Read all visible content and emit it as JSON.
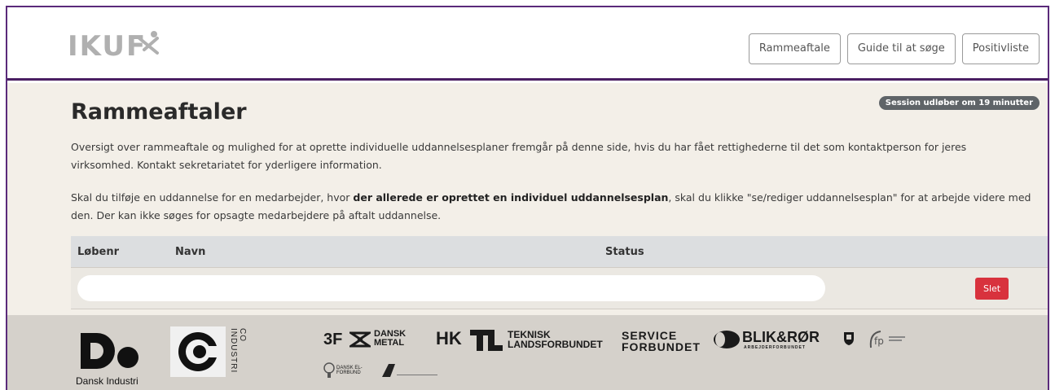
{
  "header": {
    "logo_text": "IKUF",
    "nav": [
      "Rammeaftale",
      "Guide til at søge",
      "Positivliste"
    ]
  },
  "session_badge": "Session udløber om 19 minutter",
  "page_title": "Rammeaftaler",
  "intro": "Oversigt over rammeaftale og mulighed for at oprette individuelle uddannelsesplaner fremgår på denne side, hvis du har fået rettighederne til det som kontaktperson for jeres virksomhed. Kontakt sekretariatet for yderligere information.",
  "instructions": {
    "before": "Skal du tilføje en uddannelse for en medarbejder, hvor ",
    "bold": "der allerede er oprettet en individuel uddannelsesplan",
    "after": ", skal du klikke \"se/rediger uddannelsesplan\" for at arbejde videre med den. Der kan ikke søges for opsagte medarbejdere på aftalt uddannelse."
  },
  "table": {
    "columns": [
      "Løbenr",
      "Navn",
      "Status"
    ],
    "row": {
      "delete_label": "Slet"
    }
  },
  "footer": {
    "partners": [
      {
        "name": "Dansk Industri"
      },
      {
        "name": "CO INDUSTRI"
      },
      {
        "name": "3F"
      },
      {
        "name": "DANSK METAL"
      },
      {
        "name": "HK"
      },
      {
        "name": "TEKNISK LANDSFORBUNDET"
      },
      {
        "name": "SERVICE FORBUNDET"
      },
      {
        "name": "BLIK&RØR"
      },
      {
        "name": "ARBEJDERFORBUNDET"
      },
      {
        "name": "DANSK EL-FORBUND"
      }
    ]
  },
  "colors": {
    "accent_border": "#4a1f63",
    "page_bg": "#f3efe8",
    "footer_bg": "#d5d1cb",
    "delete_red": "#d8323d",
    "badge_bg": "#5f6468"
  }
}
